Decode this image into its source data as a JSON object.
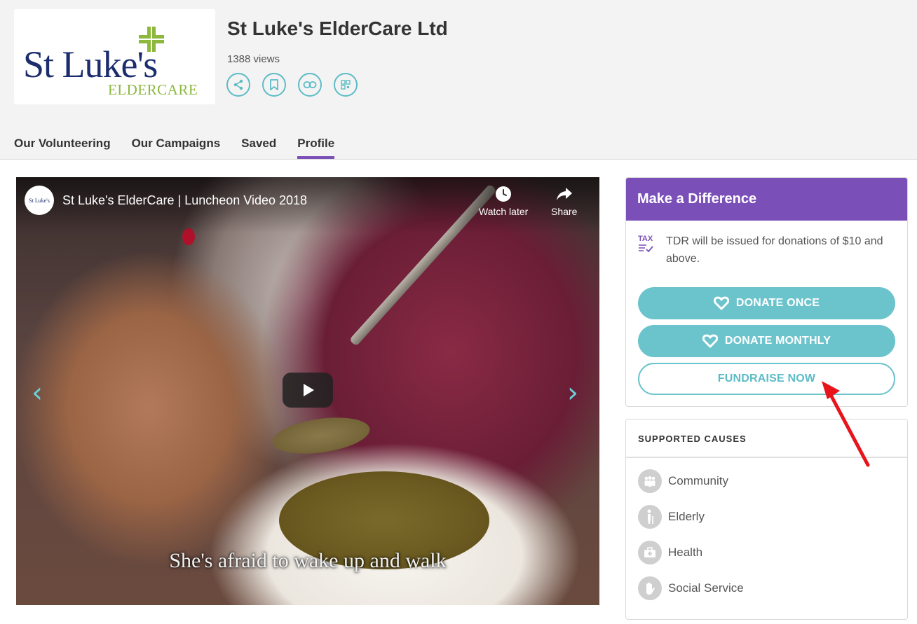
{
  "header": {
    "logo": {
      "main_text": "St Luke's",
      "sub_text": "ELDERCARE"
    },
    "org_name": "St Luke's ElderCare Ltd",
    "views": "1388 views",
    "actions": [
      "share-icon",
      "bookmark-icon",
      "link-icon",
      "qr-code-icon"
    ]
  },
  "tabs": [
    {
      "label": "Our Volunteering",
      "active": false
    },
    {
      "label": "Our Campaigns",
      "active": false
    },
    {
      "label": "Saved",
      "active": false
    },
    {
      "label": "Profile",
      "active": true
    }
  ],
  "video": {
    "title": "St Luke's ElderCare | Luncheon Video 2018",
    "watch_later": "Watch later",
    "share": "Share",
    "subtitle": "She's afraid to wake up and walk"
  },
  "donate": {
    "heading": "Make a Difference",
    "tax_label": "TAX",
    "tdr_note": "TDR will be issued for donations of $10 and above.",
    "donate_once": "DONATE ONCE",
    "donate_monthly": "DONATE MONTHLY",
    "fundraise": "FUNDRAISE NOW"
  },
  "causes": {
    "heading": "SUPPORTED CAUSES",
    "items": [
      "Community",
      "Elderly",
      "Health",
      "Social Service"
    ]
  },
  "colors": {
    "accent_purple": "#7b4fb8",
    "accent_teal": "#6bc3cc",
    "annotation_red": "#e8141c"
  }
}
